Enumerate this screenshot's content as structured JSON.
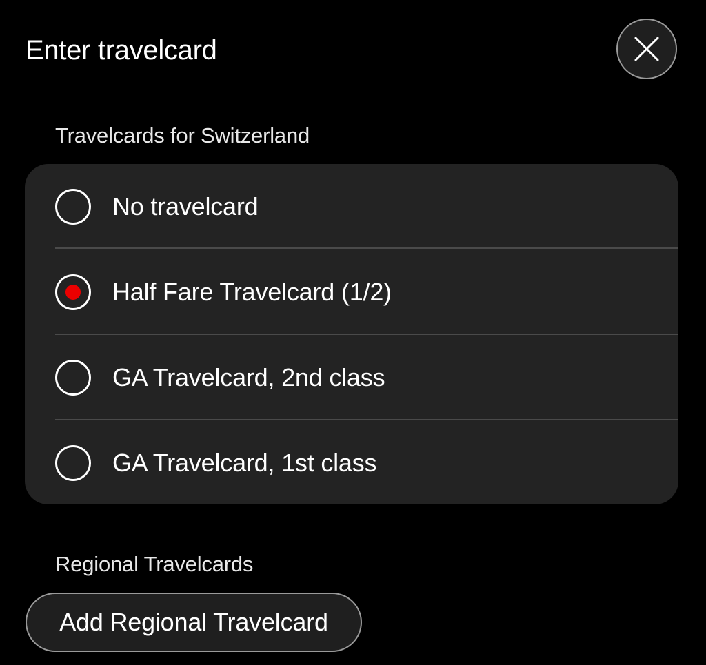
{
  "header": {
    "title": "Enter travelcard",
    "close_icon": "close-icon"
  },
  "switzerland": {
    "section_label": "Travelcards for Switzerland",
    "options": [
      {
        "label": "No travelcard",
        "selected": false
      },
      {
        "label": "Half Fare Travelcard (1/2)",
        "selected": true
      },
      {
        "label": "GA Travelcard, 2nd class",
        "selected": false
      },
      {
        "label": "GA Travelcard, 1st class",
        "selected": false
      }
    ]
  },
  "regional": {
    "section_label": "Regional Travelcards",
    "add_button_label": "Add Regional Travelcard"
  },
  "colors": {
    "background": "#000000",
    "card": "#232323",
    "accent_selected": "#eb0000",
    "divider": "#4a4a4a",
    "outline": "#9a9a9a"
  }
}
